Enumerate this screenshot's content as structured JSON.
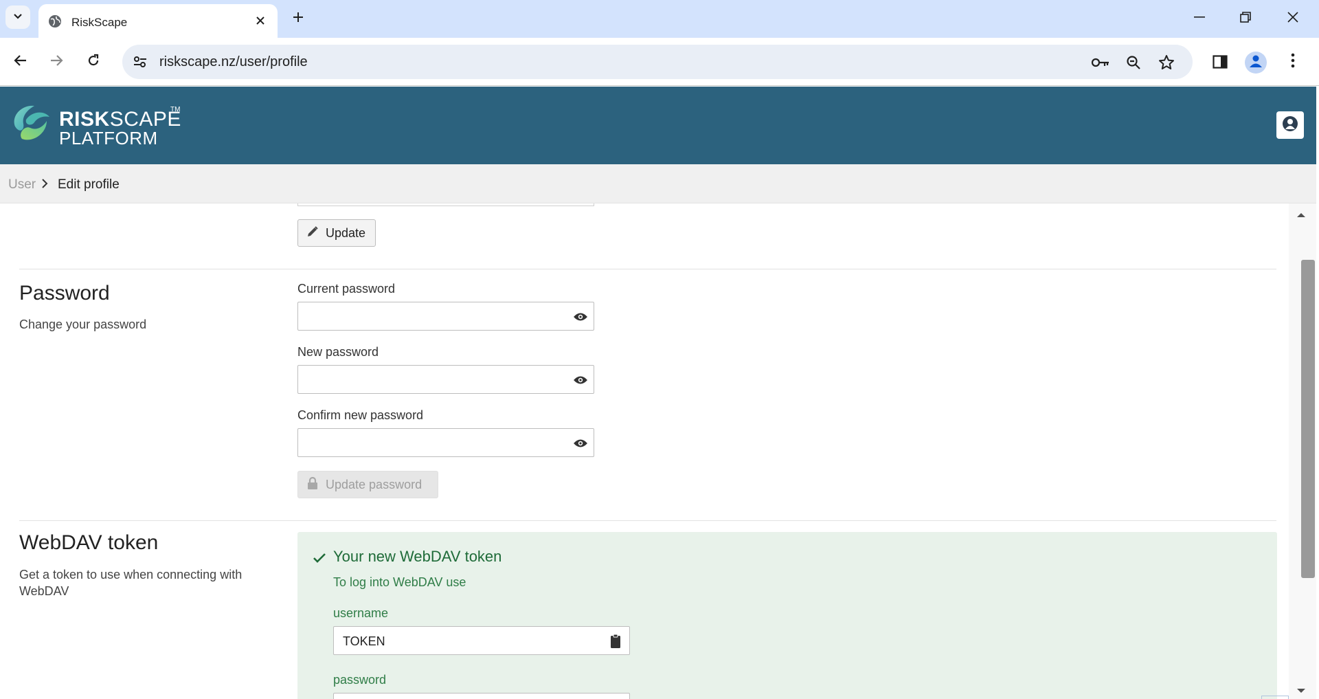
{
  "browser": {
    "tab_title": "RiskScape",
    "url": "riskscape.nz/user/profile"
  },
  "app": {
    "logo_word_bold": "RISK",
    "logo_word_light": "SCAPE",
    "logo_line2": "PLATFORM",
    "logo_tm": "TM",
    "header_color": "#2c627e"
  },
  "breadcrumb": {
    "parent": "User",
    "current": "Edit profile"
  },
  "profile": {
    "update_label": "Update"
  },
  "password": {
    "title": "Password",
    "description": "Change your password",
    "current_label": "Current password",
    "current_value": "",
    "new_label": "New password",
    "new_value": "",
    "confirm_label": "Confirm new password",
    "confirm_value": "",
    "update_label": "Update password"
  },
  "webdav": {
    "title": "WebDAV token",
    "description": "Get a token to use when connecting with WebDAV",
    "panel_heading": "Your new WebDAV token",
    "panel_sub": "To log into WebDAV use",
    "username_label": "username",
    "username_value": "TOKEN",
    "password_label": "password",
    "success_color": "#1e6b38"
  },
  "icons": {
    "tab_menu": "chevron-down-icon",
    "favicon": "globe-icon",
    "close": "close-icon",
    "new_tab": "plus-icon",
    "back": "arrow-left-icon",
    "forward": "arrow-right-icon",
    "reload": "reload-icon",
    "site_info": "tune-icon",
    "password_manager": "key-icon",
    "zoom": "zoom-out-icon",
    "bookmark": "star-icon",
    "side_panel": "side-panel-icon",
    "profile": "person-icon",
    "more": "kebab-icon",
    "eye": "eye-icon",
    "pencil": "pencil-icon",
    "lock": "lock-icon",
    "check": "check-icon",
    "clipboard": "clipboard-icon"
  }
}
